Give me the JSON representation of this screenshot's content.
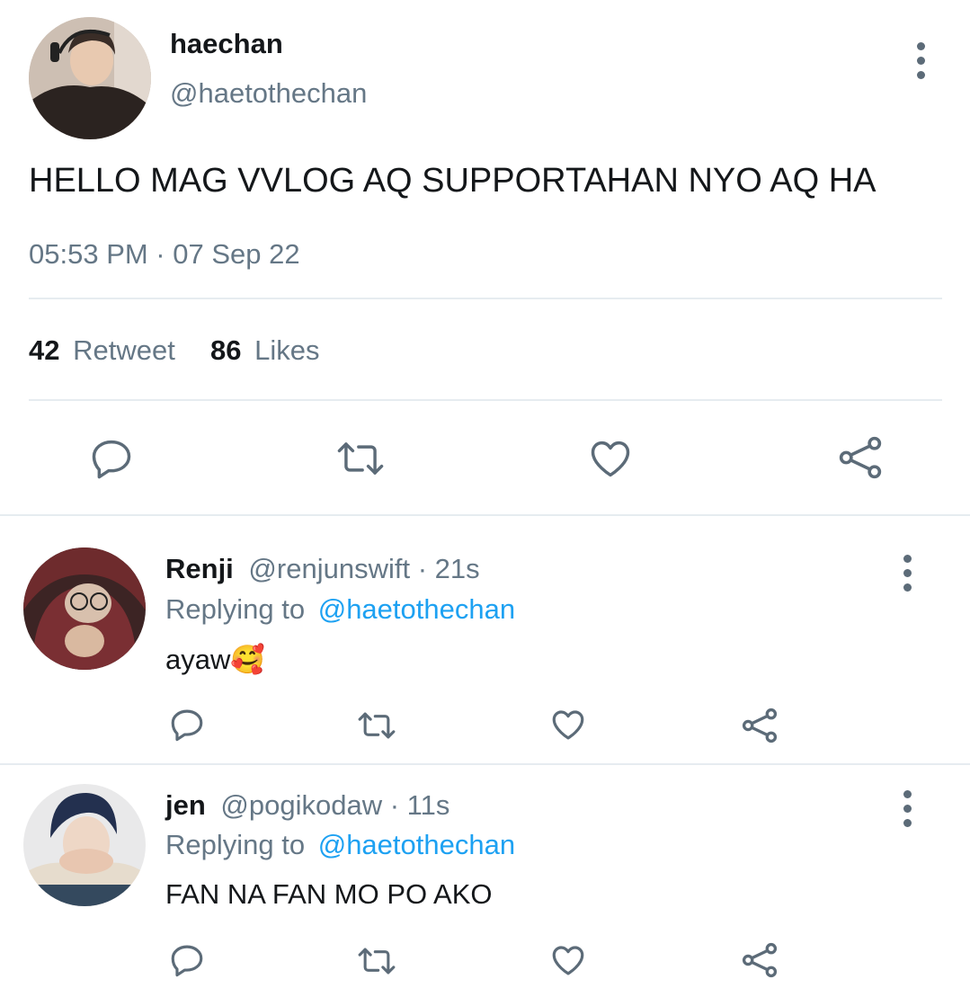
{
  "main_tweet": {
    "name": "haechan",
    "handle": "@haetothechan",
    "text": "HELLO MAG VVLOG AQ SUPPORTAHAN NYO AQ HA",
    "timestamp": "05:53 PM · 07 Sep 22",
    "retweet_count": "42",
    "retweet_label": "Retweet",
    "like_count": "86",
    "like_label": "Likes"
  },
  "replies": [
    {
      "name": "Renji",
      "handle": "@renjunswift",
      "time": "· 21s",
      "replying_label": "Replying to",
      "replying_handle": "@haetothechan",
      "text": "ayaw",
      "emoji": "🥰"
    },
    {
      "name": "jen",
      "handle": "@pogikodaw",
      "time": "· 11s",
      "replying_label": "Replying to",
      "replying_handle": "@haetothechan",
      "text": "FAN NA FAN MO PO AKO"
    }
  ],
  "icons": [
    "reply-icon",
    "retweet-icon",
    "like-icon",
    "share-icon",
    "more-options-icon"
  ],
  "colors": {
    "link": "#1da1f2",
    "muted": "#657786",
    "icon": "#5c6b78",
    "divider": "#e6ecf0"
  }
}
